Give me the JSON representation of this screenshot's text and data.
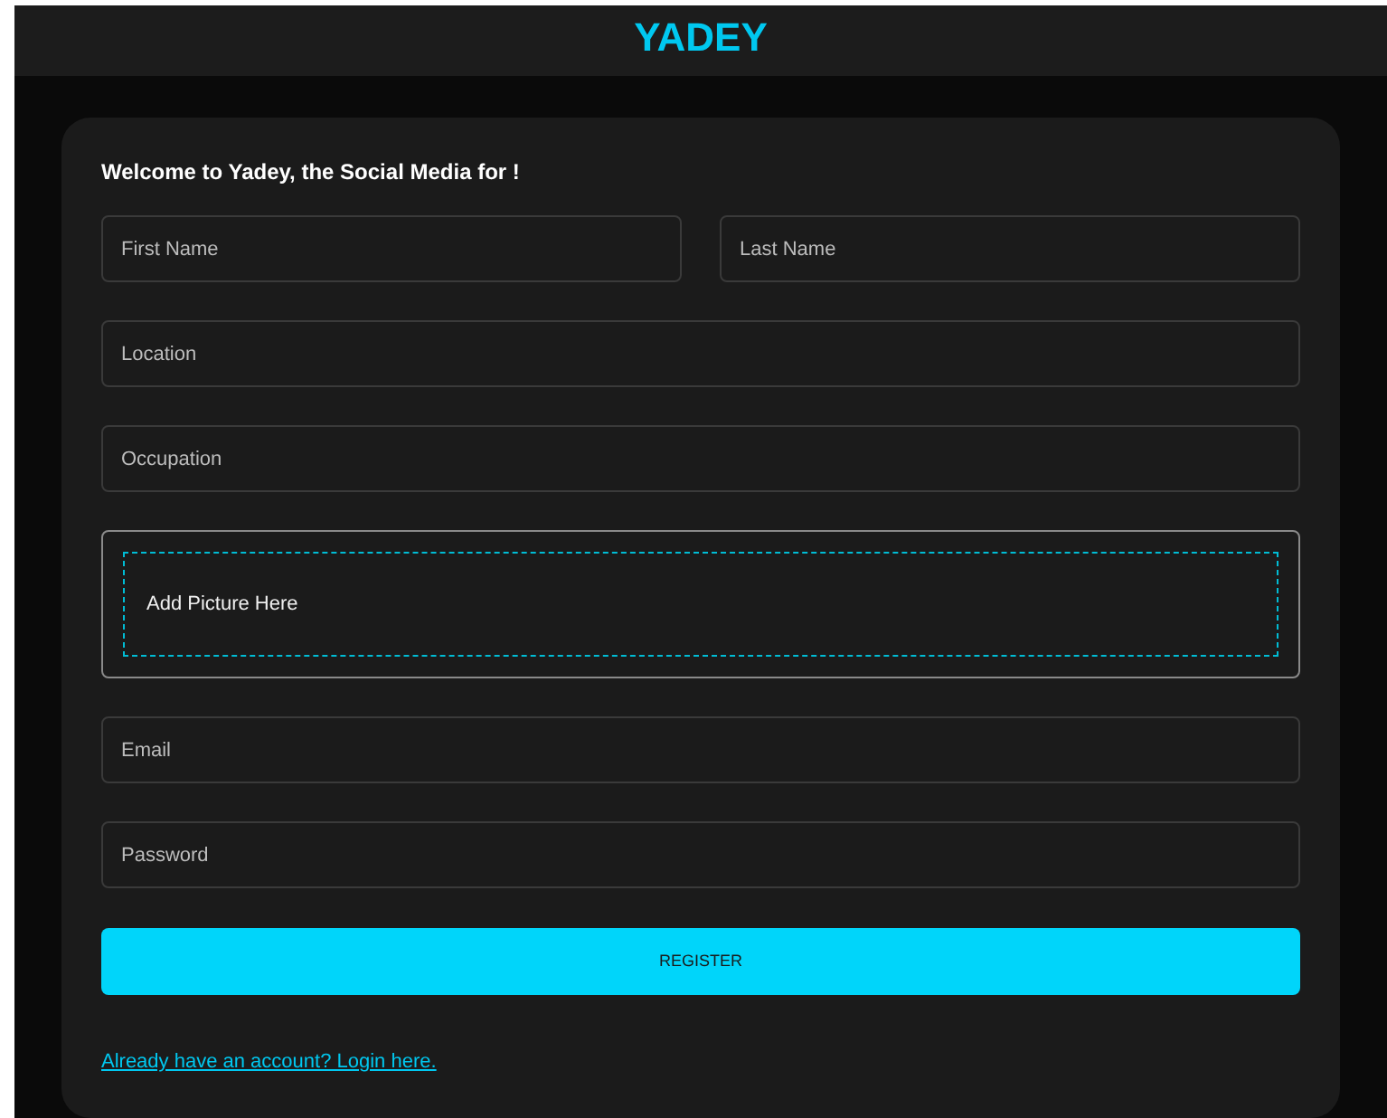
{
  "header": {
    "logo": "YADEY"
  },
  "form": {
    "welcome": "Welcome to Yadey, the Social Media for !",
    "rows": [
      {
        "fields": [
          {
            "kind": "text",
            "placeholder": "First Name"
          },
          {
            "kind": "text",
            "placeholder": "Last Name"
          }
        ]
      },
      {
        "fields": [
          {
            "kind": "text",
            "placeholder": "Location"
          }
        ]
      },
      {
        "fields": [
          {
            "kind": "text",
            "placeholder": "Occupation"
          }
        ]
      },
      {
        "fields": [
          {
            "kind": "picture",
            "label": "Add Picture Here"
          }
        ]
      },
      {
        "fields": [
          {
            "kind": "text",
            "placeholder": "Email"
          }
        ]
      },
      {
        "fields": [
          {
            "kind": "password",
            "placeholder": "Password"
          }
        ]
      }
    ],
    "submit": "REGISTER",
    "login_link": "Already have an account? Login here."
  }
}
